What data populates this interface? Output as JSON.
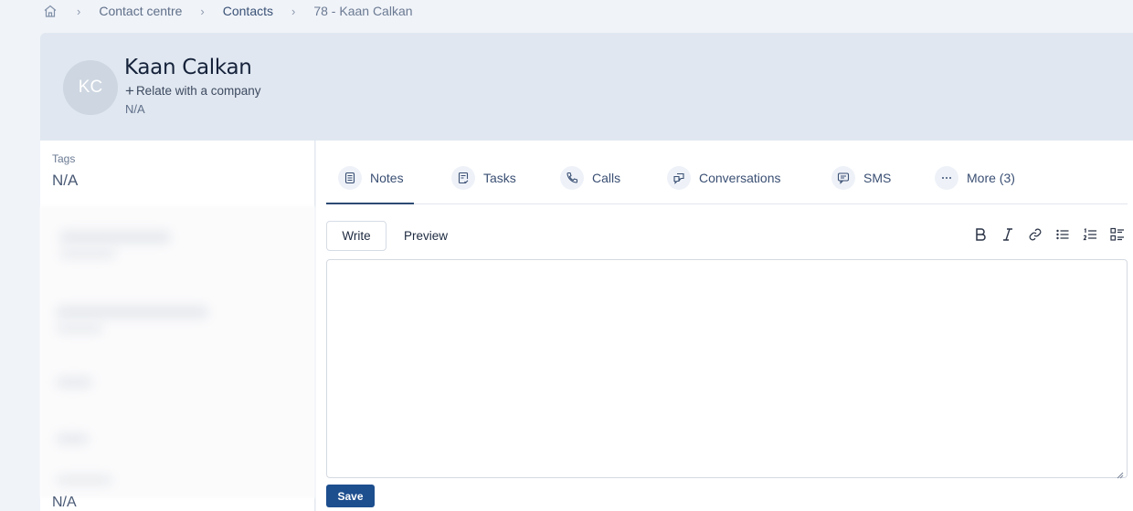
{
  "breadcrumb": {
    "items": [
      "Contact centre",
      "Contacts",
      "78 - Kaan Calkan"
    ]
  },
  "header": {
    "initials": "KC",
    "name": "Kaan Calkan",
    "relate_label": "Relate with a company",
    "company": "N/A"
  },
  "sidebar": {
    "tags_label": "Tags",
    "tags_value": "N/A",
    "bottom_value": "N/A"
  },
  "tabs": [
    {
      "label": "Notes",
      "icon": "notes-icon"
    },
    {
      "label": "Tasks",
      "icon": "tasks-icon"
    },
    {
      "label": "Calls",
      "icon": "phone-icon"
    },
    {
      "label": "Conversations",
      "icon": "chat-icon"
    },
    {
      "label": "SMS",
      "icon": "sms-icon"
    },
    {
      "label": "More (3)",
      "icon": "ellipsis-icon"
    }
  ],
  "editor": {
    "write_label": "Write",
    "preview_label": "Preview",
    "value": "",
    "save_label": "Save"
  },
  "colors": {
    "accent": "#1d4e8e",
    "header_bg": "#e0e7f0",
    "page_bg": "#f0f3f8"
  }
}
